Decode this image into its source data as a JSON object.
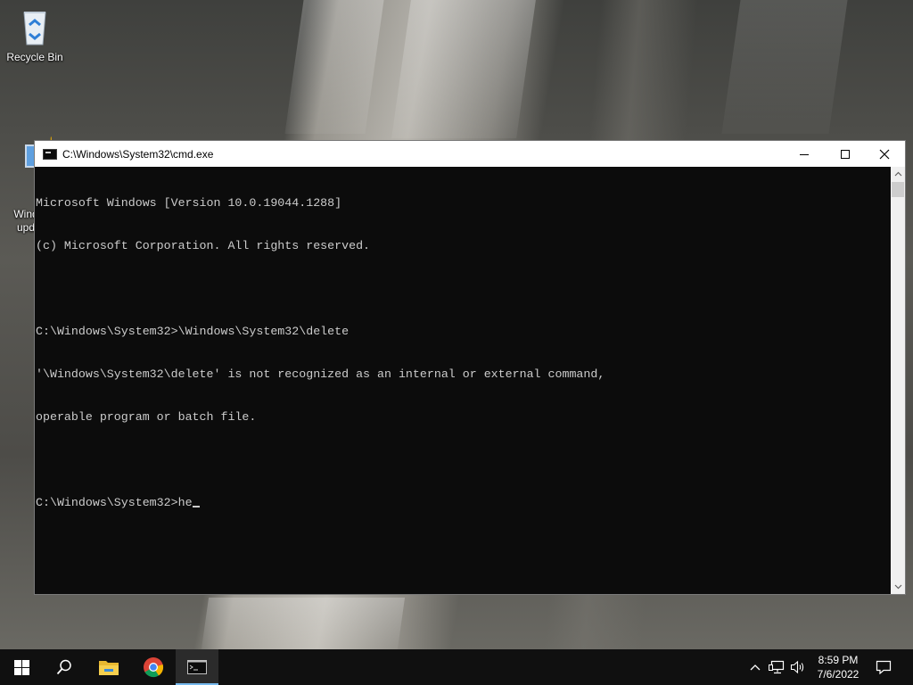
{
  "desktop": {
    "icons": [
      {
        "label": "Recycle Bin",
        "icon": "recycle-bin-icon"
      },
      {
        "label": "Windows\nupdate",
        "label_visible": "Windo\nupd",
        "icon": "windows-update-icon"
      }
    ]
  },
  "window": {
    "title": "C:\\Windows\\System32\\cmd.exe",
    "icon": "cmd-icon",
    "controls": {
      "minimize": "minimize-icon",
      "maximize": "maximize-icon",
      "close": "close-icon"
    }
  },
  "console": {
    "lines": [
      "Microsoft Windows [Version 10.0.19044.1288]",
      "(c) Microsoft Corporation. All rights reserved.",
      "",
      "C:\\Windows\\System32>\\Windows\\System32\\delete",
      "'\\Windows\\System32\\delete' is not recognized as an internal or external command,",
      "operable program or batch file.",
      ""
    ],
    "prompt": "C:\\Windows\\System32>",
    "input": "he",
    "text_color": "#cccccc",
    "background": "#0c0c0c"
  },
  "taskbar": {
    "buttons": [
      {
        "name": "start",
        "icon": "windows-logo-icon"
      },
      {
        "name": "search",
        "icon": "search-icon"
      },
      {
        "name": "file-explorer",
        "icon": "folder-icon"
      },
      {
        "name": "chrome",
        "icon": "chrome-icon"
      },
      {
        "name": "command-prompt",
        "icon": "cmd-icon",
        "active": true
      }
    ],
    "tray": {
      "icons": [
        "chevron-up-icon",
        "network-icon",
        "volume-icon"
      ],
      "time": "8:59 PM",
      "date": "7/6/2022",
      "notification_icon": "notification-icon"
    },
    "accent_color": "#76b9ed"
  }
}
